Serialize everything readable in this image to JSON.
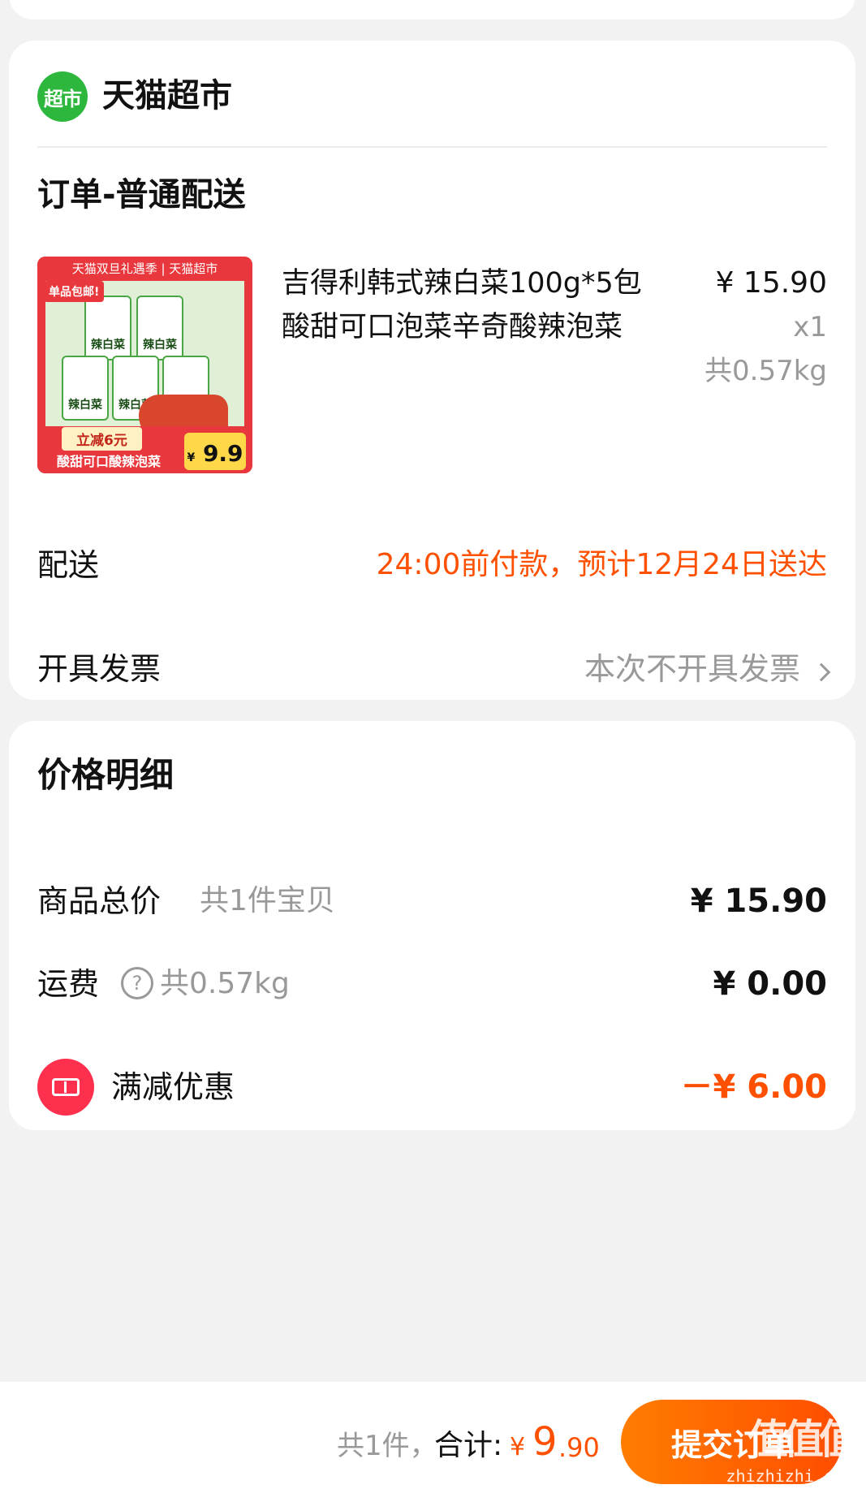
{
  "store": {
    "logo_text": "超市",
    "name": "天猫超市",
    "order_title": "订单-普通配送"
  },
  "product": {
    "title": "吉得利韩式辣白菜100g*5包酸甜可口泡菜辛奇酸辣泡菜",
    "price": "¥ 15.90",
    "qty": "x1",
    "weight": "共0.57kg",
    "image": {
      "banner": "天猫双旦礼遇季 | 天猫超市",
      "tag": "单品包邮!",
      "pack_label": "辣白菜",
      "promo": "立减6元",
      "slogan": "酸甜可口酸辣泡菜",
      "price_symbol": "¥",
      "price": "9.9"
    }
  },
  "delivery": {
    "label": "配送",
    "value": "24:00前付款，预计12月24日送达"
  },
  "invoice": {
    "label": "开具发票",
    "value": "本次不开具发票"
  },
  "price_detail": {
    "title": "价格明细",
    "goods_label": "商品总价",
    "goods_sub": "共1件宝贝",
    "goods_value": "¥ 15.90",
    "shipping_label": "运费",
    "shipping_help": "?",
    "shipping_sub": "共0.57kg",
    "shipping_value": "¥ 0.00",
    "discount_label": "满减优惠",
    "discount_value": "－¥ 6.00"
  },
  "footer": {
    "count": "共1件，",
    "total_label": "合计:",
    "total_yen": "¥",
    "total_int": "9",
    "total_dec": ".90",
    "submit_label": "提交订单"
  },
  "watermark": {
    "text": "值值值",
    "url": "zhizhizhi.com"
  },
  "colors": {
    "accent": "#ff5000",
    "store_green": "#2db83d",
    "discount_red": "#ff2f4e",
    "muted": "#999999"
  }
}
